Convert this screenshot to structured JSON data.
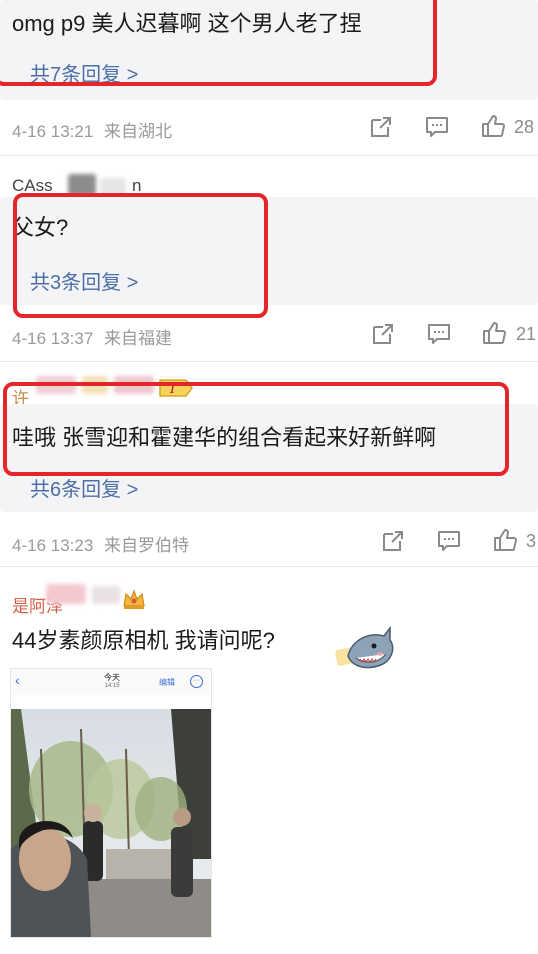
{
  "comments": [
    {
      "text": "omg p9  美人迟暮啊 这个男人老了捏",
      "reply_link": "共7条回复 >",
      "time": "4-16 13:21",
      "location": "来自湖北",
      "likes": "28"
    },
    {
      "username": "CAss",
      "username_tail": "n",
      "text": "父女?",
      "reply_link": "共3条回复 >",
      "time": "4-16 13:37",
      "location": "来自福建",
      "likes": "21"
    },
    {
      "username": "许",
      "text": "哇哦 张雪迎和霍建华的组合看起来好新鲜啊",
      "reply_link": "共6条回复 >",
      "time": "4-16 13:23",
      "location": "来自罗伯特",
      "likes": "3"
    },
    {
      "username": "是阿泽",
      "text": "44岁素颜原相机  我请问呢?",
      "photo": {
        "title": "今天",
        "subtitle": "14:15",
        "edit": "编辑"
      }
    }
  ],
  "icons": {
    "share": "share-icon",
    "comment": "comment-icon",
    "like": "thumbs-up-icon",
    "back": "back-chevron-icon",
    "more": "more-icon",
    "crown": "crown-icon",
    "level": "level-badge-icon",
    "sticker": "shark-sticker-icon"
  },
  "colors": {
    "highlight": "#e4262b",
    "link": "#4b6fa6",
    "reply_bg": "#f4f4f6",
    "meta": "#9a9a9a"
  }
}
